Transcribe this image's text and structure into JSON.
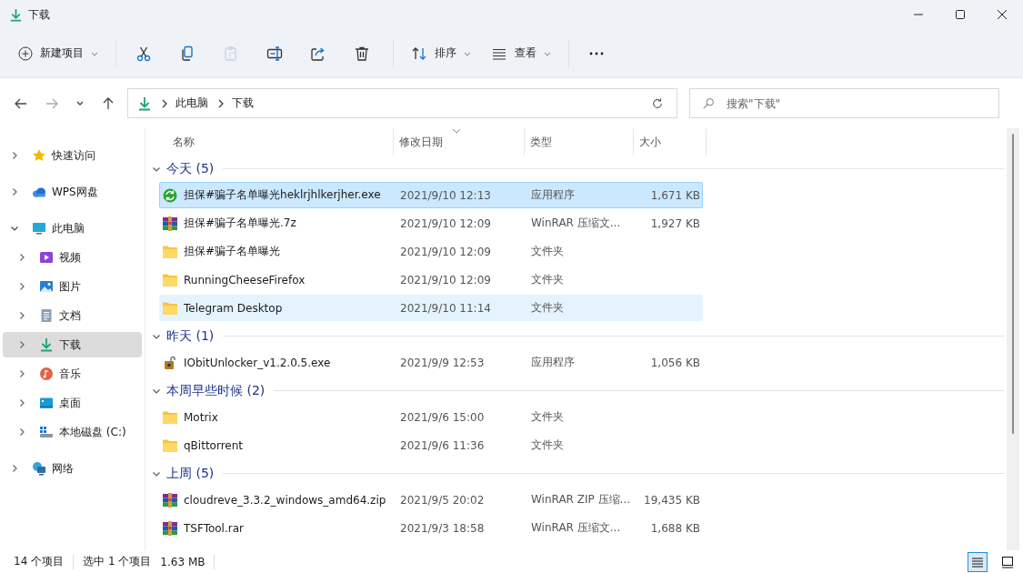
{
  "window": {
    "title": "下载"
  },
  "toolbar": {
    "new_item": "新建项目",
    "actions": [
      {
        "kind": "cut",
        "disabled": false
      },
      {
        "kind": "copy",
        "disabled": false
      },
      {
        "kind": "paste",
        "disabled": true
      },
      {
        "kind": "rename",
        "disabled": false
      },
      {
        "kind": "share",
        "disabled": false
      },
      {
        "kind": "delete",
        "disabled": false
      }
    ],
    "sort": "排序",
    "view": "查看"
  },
  "nav": [
    {
      "kind": "back",
      "disabled": false
    },
    {
      "kind": "forward",
      "disabled": true
    },
    {
      "kind": "recent",
      "disabled": false
    },
    {
      "kind": "up",
      "disabled": false
    }
  ],
  "address": {
    "crumbs": [
      "此电脑",
      "下载"
    ]
  },
  "search": {
    "placeholder": "搜索\"下载\""
  },
  "sidebar": {
    "items": [
      {
        "label": "快速访问",
        "kind": "star",
        "expanded": false,
        "selected": false
      },
      {
        "label": "WPS网盘",
        "kind": "cloud",
        "expanded": false,
        "selected": false
      },
      {
        "label": "此电脑",
        "kind": "monitor",
        "expanded": true,
        "selected": false,
        "children": [
          {
            "label": "视频",
            "kind": "video",
            "expanded": false,
            "selected": false
          },
          {
            "label": "图片",
            "kind": "image",
            "expanded": false,
            "selected": false
          },
          {
            "label": "文档",
            "kind": "document",
            "expanded": false,
            "selected": false
          },
          {
            "label": "下载",
            "kind": "download",
            "expanded": false,
            "selected": true
          },
          {
            "label": "音乐",
            "kind": "music",
            "expanded": false,
            "selected": false
          },
          {
            "label": "桌面",
            "kind": "desktop",
            "expanded": false,
            "selected": false
          },
          {
            "label": "本地磁盘 (C:)",
            "kind": "drive",
            "expanded": false,
            "selected": false
          }
        ]
      },
      {
        "label": "网络",
        "kind": "network",
        "expanded": false,
        "selected": false
      }
    ]
  },
  "columns": [
    {
      "label": "名称",
      "sorted": false
    },
    {
      "label": "修改日期",
      "sorted": true
    },
    {
      "label": "类型",
      "sorted": false
    },
    {
      "label": "大小",
      "sorted": false
    }
  ],
  "groups": [
    {
      "label": "今天 (5)",
      "expanded": true,
      "rows": [
        {
          "kind": "sync-app",
          "name": "担保#骗子名单曝光heklrjhlkerjher.exe",
          "date": "2021/9/10 12:13",
          "type": "应用程序",
          "size": "1,671 KB",
          "selected": true,
          "hovered": false
        },
        {
          "kind": "archive",
          "name": "担保#骗子名单曝光.7z",
          "date": "2021/9/10 12:09",
          "type": "WinRAR 压缩文...",
          "size": "1,927 KB",
          "selected": false,
          "hovered": false
        },
        {
          "kind": "folder",
          "name": "担保#骗子名单曝光",
          "date": "2021/9/10 12:09",
          "type": "文件夹",
          "selected": false,
          "hovered": false
        },
        {
          "kind": "folder",
          "name": "RunningCheeseFirefox",
          "date": "2021/9/10 12:09",
          "type": "文件夹",
          "selected": false,
          "hovered": false
        },
        {
          "kind": "folder",
          "name": "Telegram Desktop",
          "date": "2021/9/10 11:14",
          "type": "文件夹",
          "selected": false,
          "hovered": true
        }
      ]
    },
    {
      "label": "昨天 (1)",
      "expanded": true,
      "rows": [
        {
          "kind": "lock-app",
          "name": "IObitUnlocker_v1.2.0.5.exe",
          "date": "2021/9/9 12:53",
          "type": "应用程序",
          "size": "1,056 KB",
          "selected": false,
          "hovered": false
        }
      ]
    },
    {
      "label": "本周早些时候 (2)",
      "expanded": true,
      "rows": [
        {
          "kind": "folder",
          "name": "Motrix",
          "date": "2021/9/6 15:00",
          "type": "文件夹",
          "selected": false,
          "hovered": false
        },
        {
          "kind": "folder",
          "name": "qBittorrent",
          "date": "2021/9/6 11:36",
          "type": "文件夹",
          "selected": false,
          "hovered": false
        }
      ]
    },
    {
      "label": "上周 (5)",
      "expanded": true,
      "rows": [
        {
          "kind": "archive",
          "name": "cloudreve_3.3.2_windows_amd64.zip",
          "date": "2021/9/5 20:02",
          "type": "WinRAR ZIP 压缩...",
          "size": "19,435 KB",
          "selected": false,
          "hovered": false
        },
        {
          "kind": "archive",
          "name": "TSFTool.rar",
          "date": "2021/9/3 18:58",
          "type": "WinRAR 压缩文...",
          "size": "1,688 KB",
          "selected": false,
          "hovered": false
        }
      ]
    }
  ],
  "status_bar": {
    "count": "14 个项目",
    "selection": "选中 1 个项目",
    "size": "1.63 MB"
  },
  "view_buttons": [
    {
      "kind": "details",
      "selected": true
    },
    {
      "kind": "tiles",
      "selected": false
    }
  ]
}
